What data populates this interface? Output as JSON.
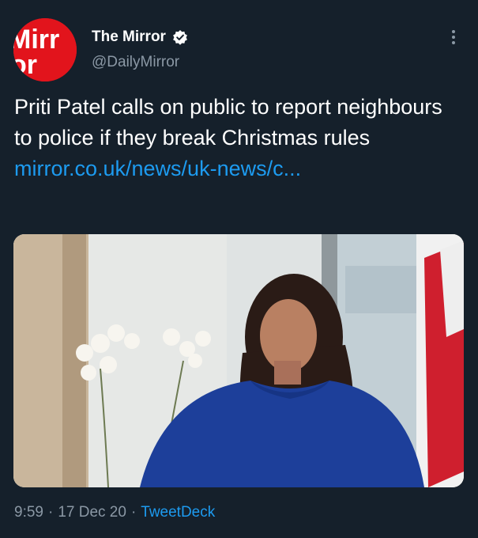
{
  "author": {
    "display_name": "The Mirror",
    "handle": "@DailyMirror",
    "avatar_logo_text": "Mirror"
  },
  "tweet": {
    "text": "Priti Patel calls on public to report neighbours to police if they break Christmas rules",
    "link": "mirror.co.uk/news/uk-news/c..."
  },
  "meta": {
    "time": "9:59",
    "separator": "·",
    "date": "17 Dec 20",
    "source": "TweetDeck"
  },
  "colors": {
    "background": "#15202b",
    "text": "#ffffff",
    "muted": "#8b98a5",
    "link": "#1d9bf0",
    "brand_red": "#e2141c"
  },
  "icons": {
    "verified": "verified-badge-icon",
    "more": "more-options-icon"
  }
}
